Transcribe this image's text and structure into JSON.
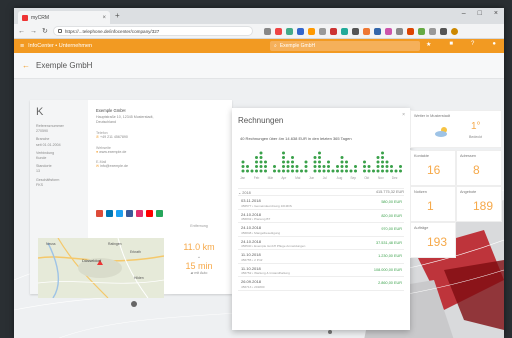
{
  "browser": {
    "tab_title": "myCRM",
    "url": "https://...telephone.de/infocenter/company/327",
    "colors": {
      "accent": "#f29a22",
      "green": "#3aa14a"
    }
  },
  "app": {
    "breadcrumb": "InfoCenter • Unternehmen",
    "search_placeholder": "Exemple GmbH"
  },
  "page": {
    "title": "Exemple GmbH"
  },
  "company": {
    "initial": "K",
    "name": "Exemple GmbH",
    "address": "Hauptstraße 10, 12345 Musterstadt, Deutschland",
    "left_meta": [
      "Referenznummer",
      "270590",
      "Branche",
      "seit 01.01.2004",
      "Verbindung",
      "Kunde",
      "Standorte",
      "13",
      "Geschäftsform",
      "FKS"
    ],
    "phone_label": "Telefon",
    "phone": "+49 211 4567890",
    "web_label": "Webseite",
    "web": "www.exemple.de",
    "mail_label": "E-Mail",
    "mail": "info@exemple.de",
    "directions": {
      "label": "Entfernung",
      "distance": "11.0 km",
      "time": "15 min",
      "mode": "mit Auto"
    },
    "map_labels": [
      "Neuss",
      "Düsseldorf",
      "Erkrath",
      "Hilden",
      "Ratingen"
    ]
  },
  "invoices": {
    "title": "Rechnungen",
    "subtitle": "40 Rechnungen über 4m 14.638 EUR in den letzten 365 Tagen",
    "months": [
      "Jan",
      "Feb",
      "Mär",
      "Apr",
      "Mai",
      "Jun",
      "Jul",
      "Aug",
      "Sep",
      "Okt",
      "Nov",
      "Dez"
    ],
    "year_label": "2018",
    "year_total": "415.775,32 EUR",
    "rows": [
      {
        "date": "03.11.2018",
        "desc": "456577 • Gemeindeordnung 1019DS",
        "amount": "580,00 EUR"
      },
      {
        "date": "24.10.2018",
        "desc": "456832 • Planung BT",
        "amount": "820,00 EUR"
      },
      {
        "date": "24.10.2018",
        "desc": "456848 • Mangelbeseitigung",
        "amount": "970,00 EUR"
      },
      {
        "date": "24.10.2018",
        "desc": "456540 • Exemple GmbH Pflege Anmeldungen",
        "amount": "37.531,48 EUR"
      },
      {
        "date": "11.10.2018",
        "desc": "456755 • 2 Prüf",
        "amount": "1.230,00 EUR"
      },
      {
        "date": "11.10.2018",
        "desc": "456752 • Wartung & Instandhaltung",
        "amount": "108.000,00 EUR"
      },
      {
        "date": "26.09.2018",
        "desc": "456713 • 201800",
        "amount": "2.860,00 EUR"
      }
    ]
  },
  "stats": {
    "weather_label": "Wetter in Musterstadt",
    "temp": "1°",
    "weather_state": "Bedeckt",
    "boxes": [
      {
        "label": "Kontakte",
        "value": "16"
      },
      {
        "label": "Adressen",
        "value": "8"
      },
      {
        "label": "Notizen",
        "value": "1"
      },
      {
        "label": "Angebote",
        "value": "189"
      },
      {
        "label": "Aufträge",
        "value": "193"
      }
    ]
  }
}
